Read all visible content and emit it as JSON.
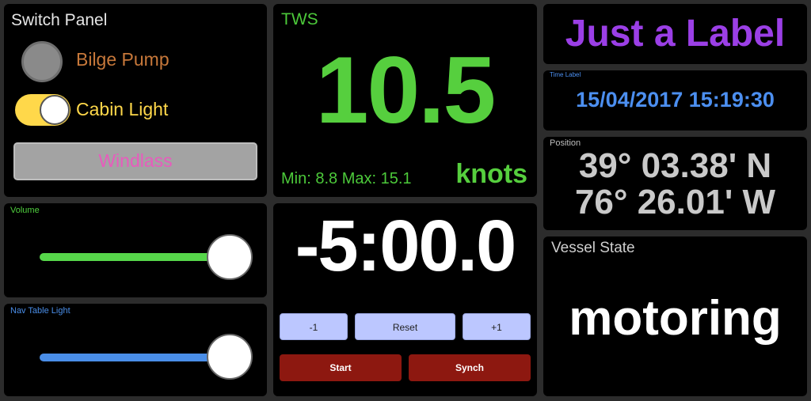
{
  "switch_panel": {
    "title": "Switch Panel",
    "bilge_pump": {
      "label": "Bilge Pump",
      "state": "off",
      "color": "#c7783a"
    },
    "cabin_light": {
      "label": "Cabin Light",
      "state": "on",
      "color": "#ffd84a"
    },
    "windlass": {
      "label": "Windlass"
    }
  },
  "volume": {
    "label": "Volume",
    "level": 0.85,
    "color": "#56d64a"
  },
  "nav_table_light": {
    "label": "Nav Table Light",
    "level": 0.85,
    "color": "#4a8ee8"
  },
  "tws": {
    "title": "TWS",
    "value": "10.5",
    "minmax": "Min: 8.8 Max: 15.1",
    "unit": "knots"
  },
  "timer": {
    "value": "-5:00.0",
    "buttons": {
      "minus": "-1",
      "reset": "Reset",
      "plus": "+1",
      "start": "Start",
      "synch": "Synch"
    }
  },
  "just_label": {
    "text": "Just a Label"
  },
  "time_label": {
    "title": "Time Label",
    "value": "15/04/2017 15:19:30"
  },
  "position": {
    "title": "Position",
    "lat": "39° 03.38' N",
    "lon": "76° 26.01' W"
  },
  "vessel_state": {
    "title": "Vessel State",
    "value": "motoring"
  }
}
